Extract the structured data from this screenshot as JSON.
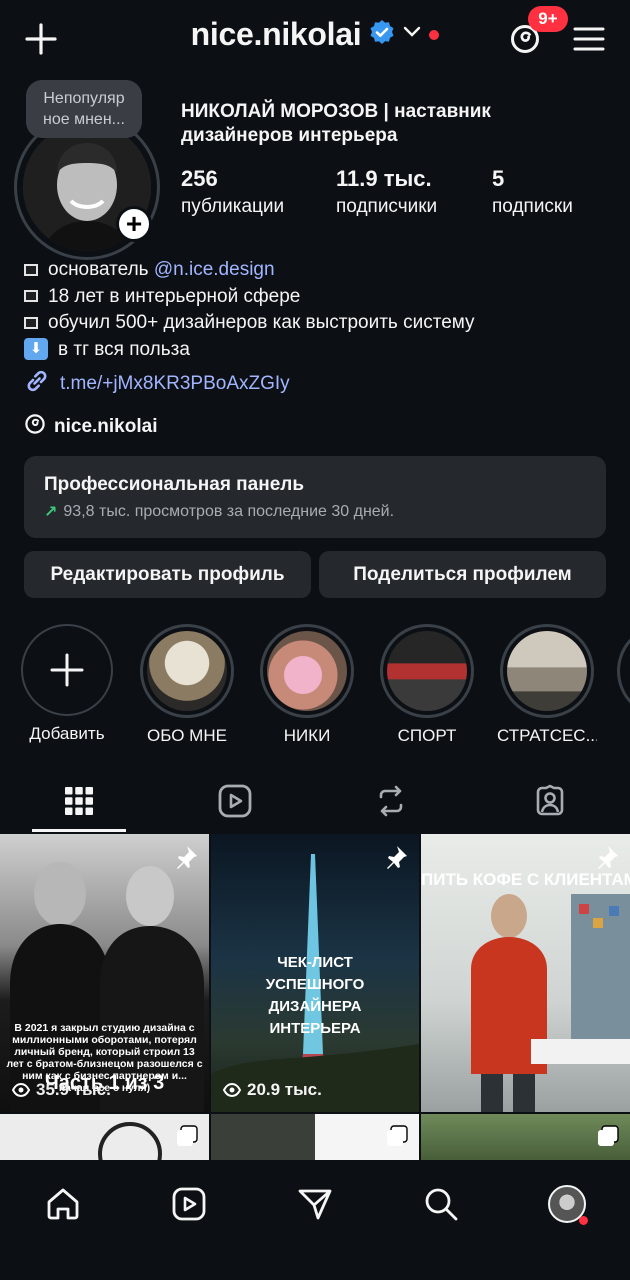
{
  "header": {
    "username": "nice.nikolai",
    "notifications_badge": "9+"
  },
  "profile": {
    "note": "Непопуляр ное мнен...",
    "display_name": "НИКОЛАЙ МОРОЗОВ | наставник дизайнеров интерьера",
    "stats": [
      {
        "value": "256",
        "label": "публикации"
      },
      {
        "value": "11.9 тыс.",
        "label": "подписчики"
      },
      {
        "value": "5",
        "label": "подписки"
      }
    ],
    "bio": {
      "line1_prefix": "основатель ",
      "line1_mention": "@n.ice.design",
      "line2": "18 лет в интерьерной сфере",
      "line3": "обучил 500+ дизайнеров как выстроить систему",
      "line4": "в тг вся польза"
    },
    "link": "t.me/+jMx8KR3PBoAxZGIy",
    "threads_handle": "nice.nikolai"
  },
  "pro_panel": {
    "title": "Профессиональная панель",
    "subtitle": "93,8 тыс. просмотров за последние 30 дней."
  },
  "buttons": {
    "edit": "Редактировать профиль",
    "share": "Поделиться профилем"
  },
  "highlights": [
    {
      "label": "Добавить"
    },
    {
      "label": "ОБО МНЕ"
    },
    {
      "label": "НИКИ"
    },
    {
      "label": "СПОРТ"
    },
    {
      "label": "СТРАТСЕС..."
    }
  ],
  "posts": [
    {
      "caption": "В 2021 я закрыл студию дизайна с миллионными оборотами, потерял личный бренд, который строил 13 лет с братом-близнецом разошелся с ним как с бизнес партнером и... начал все с нуля)",
      "overlay": "Часть 1 из 3",
      "views": "35.9 тыс."
    },
    {
      "caption": "ЧЕК-ЛИСТ УСПЕШНОГО ДИЗАЙНЕРА ИНТЕРЬЕРА",
      "views": "20.9 тыс."
    },
    {
      "caption": "ПИТЬ КОФЕ С КЛИЕНТАМИ"
    }
  ],
  "colors": {
    "background": "#0c1014",
    "surface": "#25292e",
    "link": "#a2b5ff",
    "badge": "#ff3040",
    "verified": "#3897f0"
  }
}
